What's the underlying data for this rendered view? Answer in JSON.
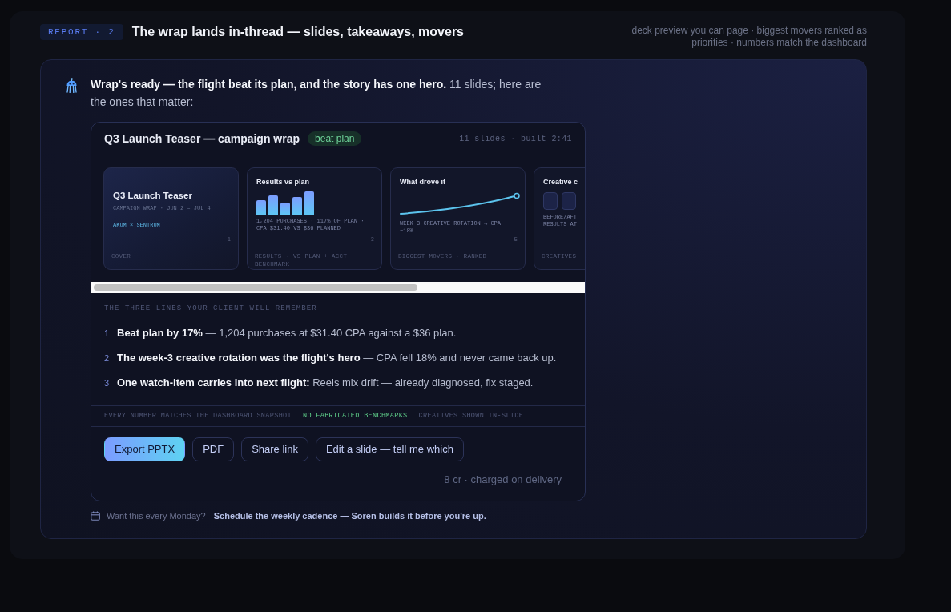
{
  "header": {
    "badge": "REPORT · 2",
    "title": "The wrap lands in-thread — slides, takeaways, movers",
    "note": "deck preview you can page · biggest movers ranked as priorities · numbers match the dashboard"
  },
  "message": {
    "text": "**Wrap's ready — the flight beat its plan, and the story has one hero.** 11 slides; here are the ones that matter:"
  },
  "deck": {
    "title": "Q3 Launch Teaser — campaign wrap",
    "badge": "beat plan",
    "meta": "11 slides · built 2:41",
    "slides": [
      {
        "kind": "cover",
        "title": "Q3 Launch Teaser",
        "subtitle": "CAMPAIGN WRAP · JUN 2 – JUL 4",
        "credit": "AKUM × SENTRUM",
        "page": "1",
        "footer": "COVER"
      },
      {
        "kind": "bars",
        "title": "Results vs plan",
        "caption": "1,204 PURCHASES · 117% OF PLAN · CPA $31.40 VS $36 PLANNED",
        "page": "3",
        "footer": "RESULTS · VS PLAN + ACCT BENCHMARK"
      },
      {
        "kind": "trend",
        "title": "What drove it",
        "caption": "WEEK 3 CREATIVE ROTATION → CPA −18%",
        "page": "5",
        "footer": "BIGGEST MOVERS · RANKED"
      },
      {
        "kind": "thumbs",
        "title": "Creative c",
        "caption": "BEFORE/AFT RESULTS AT",
        "footer": "CREATIVES"
      }
    ],
    "takeaways_label": "THE THREE LINES YOUR CLIENT WILL REMEMBER",
    "takeaways": [
      {
        "number": "1",
        "text": "**Beat plan by 17%** — 1,204 purchases at $31.40 CPA against a $36 plan."
      },
      {
        "number": "2",
        "text": "**The week-3 creative rotation was the flight's hero** — CPA fell 18% and never came back up."
      },
      {
        "number": "3",
        "text": "**One watch-item carries into next flight:** Reels mix drift — already diagnosed, fix staged."
      }
    ],
    "checks": [
      {
        "text": "EVERY NUMBER MATCHES THE DASHBOARD SNAPSHOT",
        "highlight": false
      },
      {
        "text": "NO FABRICATED BENCHMARKS",
        "highlight": true
      },
      {
        "text": "CREATIVES SHOWN IN-SLIDE",
        "highlight": false
      }
    ],
    "actions": [
      {
        "label": "Export PPTX",
        "kind": "primary"
      },
      {
        "label": "PDF",
        "kind": "secondary"
      },
      {
        "label": "Share link",
        "kind": "secondary"
      },
      {
        "label": "Edit a slide — tell me which",
        "kind": "secondary"
      }
    ],
    "cost": "8 cr · charged on delivery"
  },
  "followup": {
    "prompt": "Want this every Monday?",
    "link": "Schedule the weekly cadence — Soren builds it before you're up."
  }
}
